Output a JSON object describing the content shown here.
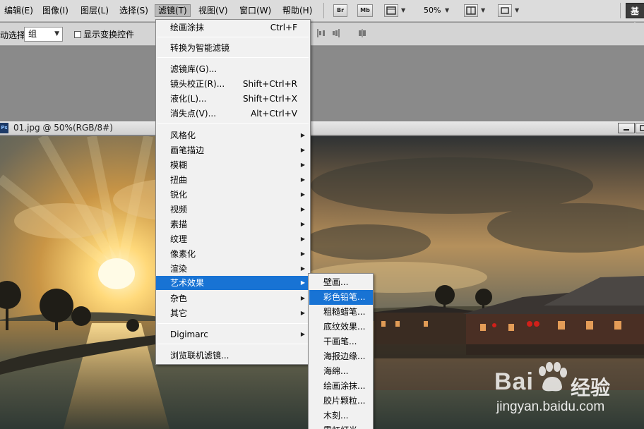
{
  "menubar": {
    "items": [
      {
        "label": "编辑(E)"
      },
      {
        "label": "图像(I)"
      },
      {
        "label": "图层(L)"
      },
      {
        "label": "选择(S)"
      },
      {
        "label": "滤镜(T)"
      },
      {
        "label": "视图(V)"
      },
      {
        "label": "窗口(W)"
      },
      {
        "label": "帮助(H)"
      }
    ],
    "bridge_label": "Br",
    "minibridge_label": "Mb",
    "zoom": "50%",
    "workspace_label": "基本"
  },
  "options_bar": {
    "auto_select_label": "动选择:",
    "auto_select_value": "组",
    "show_transform_label": "显示变换控件"
  },
  "document": {
    "ps_badge": "Ps",
    "title": "01.jpg @ 50%(RGB/8#)"
  },
  "filter_menu": {
    "group1": [
      {
        "label": "绘画涂抹",
        "shortcut": "Ctrl+F"
      }
    ],
    "group2": [
      {
        "label": "转换为智能滤镜"
      }
    ],
    "group3": [
      {
        "label": "滤镜库(G)..."
      },
      {
        "label": "镜头校正(R)...",
        "shortcut": "Shift+Ctrl+R"
      },
      {
        "label": "液化(L)...",
        "shortcut": "Shift+Ctrl+X"
      },
      {
        "label": "消失点(V)...",
        "shortcut": "Alt+Ctrl+V"
      }
    ],
    "group4": [
      {
        "label": "风格化"
      },
      {
        "label": "画笔描边"
      },
      {
        "label": "模糊"
      },
      {
        "label": "扭曲"
      },
      {
        "label": "锐化"
      },
      {
        "label": "视频"
      },
      {
        "label": "素描"
      },
      {
        "label": "纹理"
      },
      {
        "label": "像素化"
      },
      {
        "label": "渲染"
      },
      {
        "label": "艺术效果"
      },
      {
        "label": "杂色"
      },
      {
        "label": "其它"
      }
    ],
    "group5": [
      {
        "label": "Digimarc"
      }
    ],
    "group6": [
      {
        "label": "浏览联机滤镜..."
      }
    ]
  },
  "artistic_submenu": {
    "items": [
      {
        "label": "壁画..."
      },
      {
        "label": "彩色铅笔..."
      },
      {
        "label": "粗糙蜡笔..."
      },
      {
        "label": "底纹效果..."
      },
      {
        "label": "干画笔..."
      },
      {
        "label": "海报边缘..."
      },
      {
        "label": "海绵..."
      },
      {
        "label": "绘画涂抹..."
      },
      {
        "label": "胶片颗粒..."
      },
      {
        "label": "木刻..."
      },
      {
        "label": "霓虹灯光..."
      }
    ]
  },
  "watermark": {
    "logo": "Bai",
    "logo_cn": "经验",
    "url": "jingyan.baidu.com"
  },
  "colors": {
    "menu_highlight": "#1873d4",
    "menubar_bg": "#dcdcdc",
    "workspace_bg": "#8a8a8a"
  }
}
